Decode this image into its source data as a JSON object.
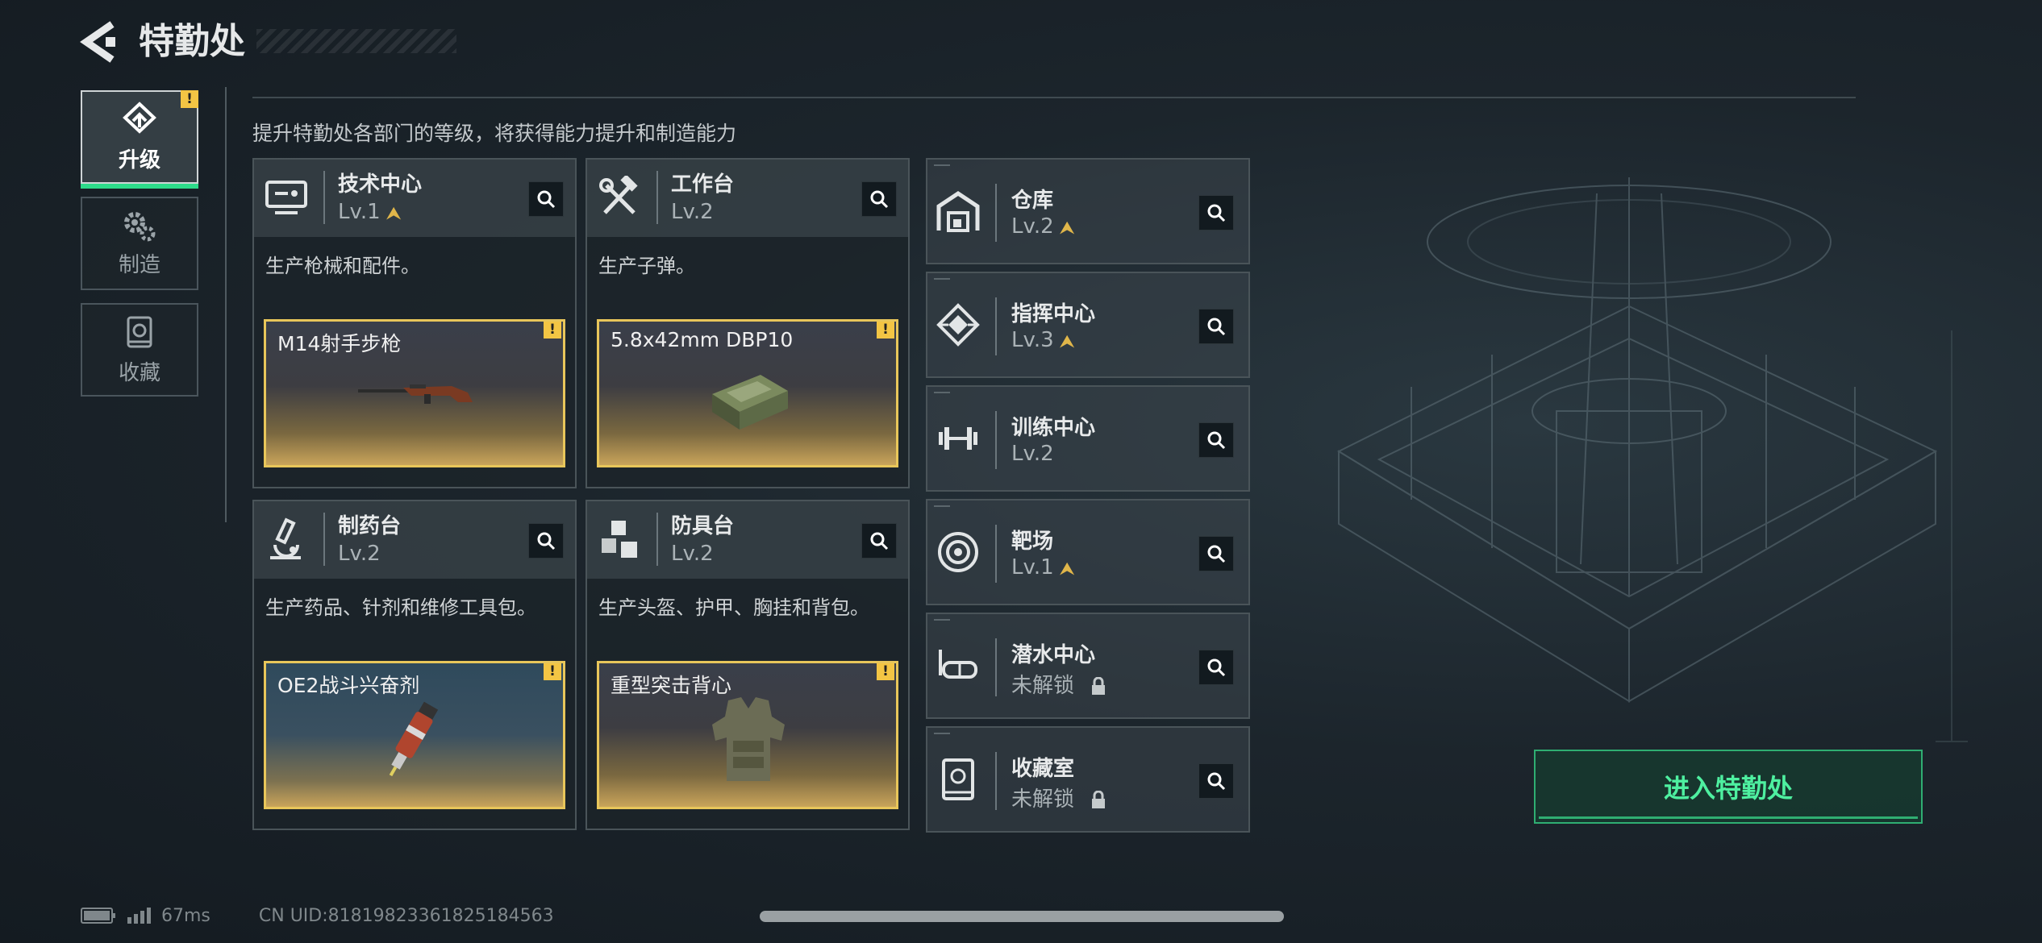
{
  "header": {
    "title": "特勤处"
  },
  "side_tabs": [
    {
      "label": "升级",
      "active": true,
      "warning": "!"
    },
    {
      "label": "制造",
      "active": false
    },
    {
      "label": "收藏",
      "active": false
    }
  ],
  "description": "提升特勤处各部门的等级，将获得能力提升和制造能力",
  "departments": [
    {
      "name": "技术中心",
      "level": "Lv.1",
      "upgradable": true,
      "desc": "生产枪械和配件。",
      "product": {
        "name": "M14射手步枪",
        "warning": "!"
      }
    },
    {
      "name": "工作台",
      "level": "Lv.2",
      "upgradable": false,
      "desc": "生产子弹。",
      "product": {
        "name": "5.8x42mm DBP10",
        "warning": "!"
      }
    },
    {
      "name": "制药台",
      "level": "Lv.2",
      "upgradable": false,
      "desc": "生产药品、针剂和维修工具包。",
      "product": {
        "name": "OE2战斗兴奋剂",
        "warning": "!"
      }
    },
    {
      "name": "防具台",
      "level": "Lv.2",
      "upgradable": false,
      "desc": "生产头盔、护甲、胸挂和背包。",
      "product": {
        "name": "重型突击背心",
        "warning": "!"
      }
    }
  ],
  "facilities": [
    {
      "name": "仓库",
      "level": "Lv.2",
      "upgradable": true,
      "icon": "warehouse-icon"
    },
    {
      "name": "指挥中心",
      "level": "Lv.3",
      "upgradable": true,
      "icon": "command-center-icon"
    },
    {
      "name": "训练中心",
      "level": "Lv.2",
      "upgradable": false,
      "icon": "dumbbell-icon"
    },
    {
      "name": "靶场",
      "level": "Lv.1",
      "upgradable": true,
      "icon": "target-icon"
    },
    {
      "name": "潜水中心",
      "level": "未解锁",
      "locked": true,
      "icon": "diving-mask-icon"
    },
    {
      "name": "收藏室",
      "level": "未解锁",
      "locked": true,
      "icon": "collection-room-icon"
    }
  ],
  "enter_button": "进入特勤处",
  "footer": {
    "ping": "67ms",
    "uid": "CN UID:81819823361825184563"
  },
  "colors": {
    "accent_green": "#2ddc8a",
    "warning_yellow": "#f3c544",
    "upgrade_gold": "#e0b64a"
  }
}
